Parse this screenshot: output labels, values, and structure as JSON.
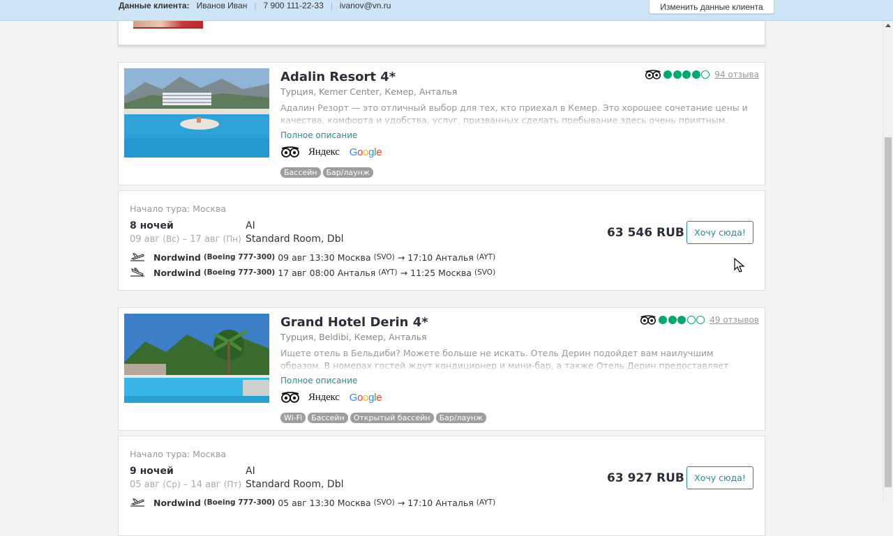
{
  "client_bar": {
    "label": "Данные клиента:",
    "name": "Иванов Иван",
    "sep1": "|",
    "phone": "7 900 111-22-33",
    "sep2": "|",
    "email": "ivanov@vn.ru",
    "edit_button": "Изменить данные клиента"
  },
  "colors": {
    "accent": "#2d8a95",
    "tripadvisor_green": "#00aa6c",
    "client_bar_bg": "#cde5f7",
    "tag_bg": "#9e9e9e"
  },
  "hotels": [
    {
      "name": "Adalin Resort 4*",
      "location": "Турция, Kemer Center, Кемер, Анталья",
      "description": "Адалин Резорт — это отличный выбор для тех, кто приехал в Кемер. Это хорошее сочетание цены и качества, комфорта и удобства, услуг, призванных сделать пребывание здесь очень приятным.",
      "full_description_link": "Полное описание",
      "rating_filled": 4,
      "rating_max": 5,
      "reviews": "94 отзыва",
      "sources": [
        "tripadvisor-icon",
        "Яндекс",
        "Google"
      ],
      "tags": [
        "Бассейн",
        "Бар/лаунж"
      ],
      "tour": {
        "start": "Начало тура: Москва",
        "nights": "8 ночей",
        "dates_main": "09 авг",
        "dates_from_day": "(Вс)",
        "dates_dash": "–",
        "dates_to": "17 авг",
        "dates_to_day": "(Пн)",
        "meal": "AI",
        "room": "Standard Room, Dbl",
        "price": "63 546 RUB",
        "button": "Хочу сюда!",
        "flights": [
          {
            "airline": "Nordwind",
            "aircraft": "(Boeing 777-300)",
            "date": "09 авг 13:30",
            "from_city": "Москва",
            "from_code": "(SVO)",
            "arrow": "→",
            "arr_time": "17:10",
            "to_city": "Анталья",
            "to_code": "(AYT)"
          },
          {
            "airline": "Nordwind",
            "aircraft": "(Boeing 777-300)",
            "date": "17 авг 08:00",
            "from_city": "Анталья",
            "from_code": "(AYT)",
            "arrow": "→",
            "arr_time": "11:25",
            "to_city": "Москва",
            "to_code": "(SVO)"
          }
        ]
      }
    },
    {
      "name": "Grand Hotel Derin 4*",
      "location": "Турция, Beldibi, Кемер, Анталья",
      "description": "Ищете отель в Бельдиби? Можете больше не искать. Отель Дерин подойдет вам наилучшим образом. В номерах гостей ждут кондиционер и мини-бар, а также Отель Дерин предоставляет бесплатный Wi-Fi.",
      "full_description_link": "Полное описание",
      "rating_filled": 3,
      "rating_max": 5,
      "reviews": "49 отзывов",
      "sources": [
        "tripadvisor-icon",
        "Яндекс",
        "Google"
      ],
      "tags": [
        "Wi-Fi",
        "Бассейн",
        "Открытый бассейн",
        "Бар/лаунж"
      ],
      "tour": {
        "start": "Начало тура: Москва",
        "nights": "9 ночей",
        "dates_main": "05 авг",
        "dates_from_day": "(Ср)",
        "dates_dash": "–",
        "dates_to": "14 авг",
        "dates_to_day": "(Пт)",
        "meal": "AI",
        "room": "Standard Room, Dbl",
        "price": "63 927 RUB",
        "button": "Хочу сюда!",
        "flights": [
          {
            "airline": "Nordwind",
            "aircraft": "(Boeing 777-300)",
            "date": "05 авг 13:30",
            "from_city": "Москва",
            "from_code": "(SVO)",
            "arrow": "→",
            "arr_time": "17:10",
            "to_city": "Анталья",
            "to_code": "(AYT)"
          }
        ]
      }
    }
  ]
}
